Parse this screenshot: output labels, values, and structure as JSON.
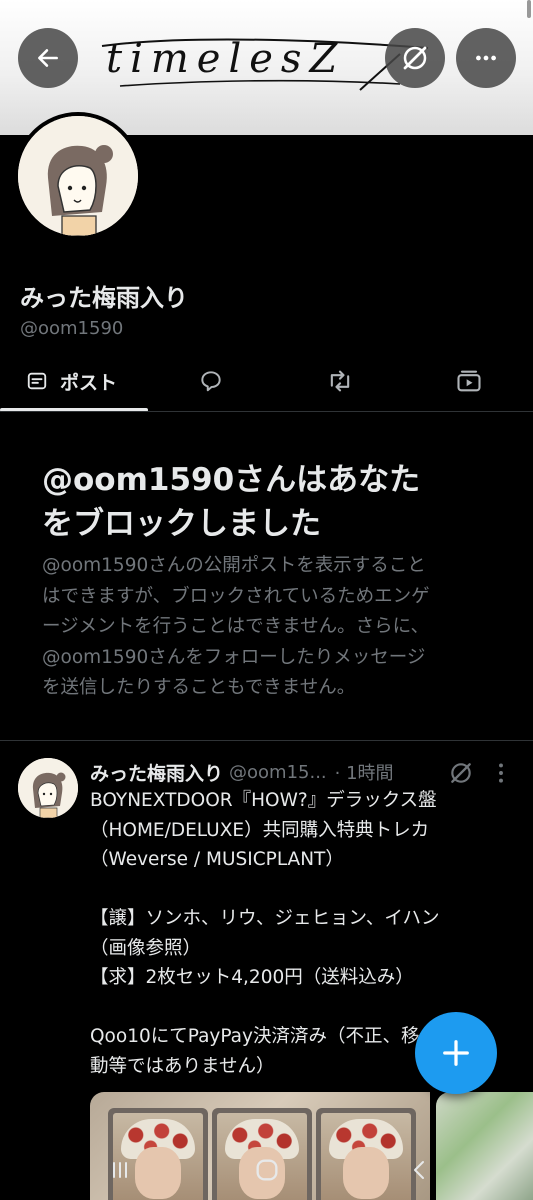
{
  "banner": {
    "signature_text": "timelesZ",
    "back_label": "Back",
    "grok_label": "Grok",
    "more_label": "More"
  },
  "profile": {
    "display_name": "みった梅雨入り",
    "handle": "@oom1590"
  },
  "tabs": [
    {
      "label": "ポスト",
      "icon": "post-icon",
      "selected": true
    },
    {
      "label": "",
      "icon": "reply-bubble-icon",
      "selected": false
    },
    {
      "label": "",
      "icon": "repost-icon",
      "selected": false
    },
    {
      "label": "",
      "icon": "media-icon",
      "selected": false
    }
  ],
  "blocked_notice": {
    "title_line1": "@oom1590さんはあなた",
    "title_line2": "をブロックしました",
    "body_lines": [
      "@oom1590さんの公開ポストを表示すること",
      "はできますが、ブロックされているためエンゲ",
      "ージメントを行うことはできません。さらに、",
      "@oom1590さんをフォローしたりメッセージ",
      "を送信したりすることもできません。"
    ]
  },
  "post": {
    "author_name": "みった梅雨入り",
    "author_handle": "@oom15...",
    "time": "· 1時間",
    "lines": [
      "BOYNEXTDOOR『HOW?』デラックス盤",
      "（HOME/DELUXE）共同購入特典トレカ",
      "（Weverse / MUSICPLANT）",
      "",
      "【譲】ソンホ、リウ、ジェヒョン、イハン",
      "（画像参照）",
      "【求】2枚セット4,200円（送料込み）",
      "",
      "Qoo10にてPayPay決済済み（不正、移",
      "動等ではありません）"
    ]
  },
  "colors": {
    "background": "#000000",
    "text_primary": "#e7e9ea",
    "text_secondary": "#71767b",
    "accent": "#1d9bf0",
    "divider": "#2f3336"
  }
}
